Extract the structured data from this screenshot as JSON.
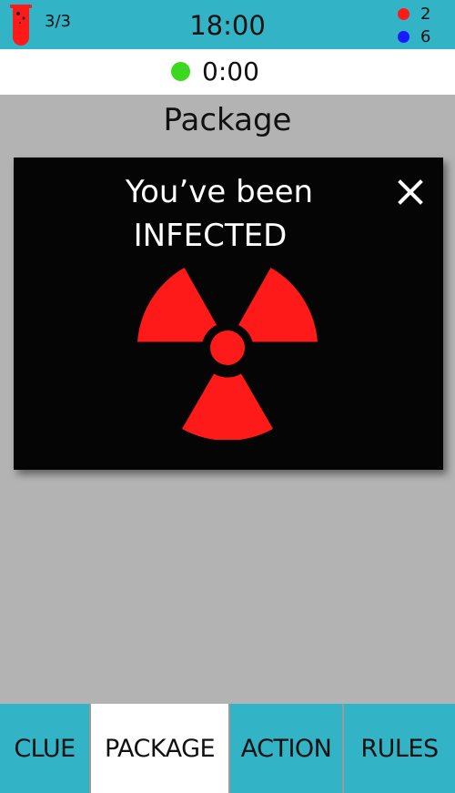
{
  "header": {
    "lives": "3/3",
    "clock": "18:00",
    "scores": {
      "red": "2",
      "blue": "6"
    }
  },
  "timer": {
    "value": "0:00"
  },
  "main": {
    "title": "Package"
  },
  "modal": {
    "line1": "You’ve been",
    "line2": "INFECTED",
    "icon": "radiation-hazard-icon"
  },
  "tabs": [
    {
      "label": "CLUE",
      "active": false
    },
    {
      "label": "PACKAGE",
      "active": true
    },
    {
      "label": "ACTION",
      "active": false
    },
    {
      "label": "RULES",
      "active": false
    }
  ],
  "colors": {
    "accent_teal": "#33b3c6",
    "hazard_red": "#ff1a1a",
    "timer_green": "#3bd91e",
    "score_red": "#ff1a1a",
    "score_blue": "#1a1aff"
  }
}
